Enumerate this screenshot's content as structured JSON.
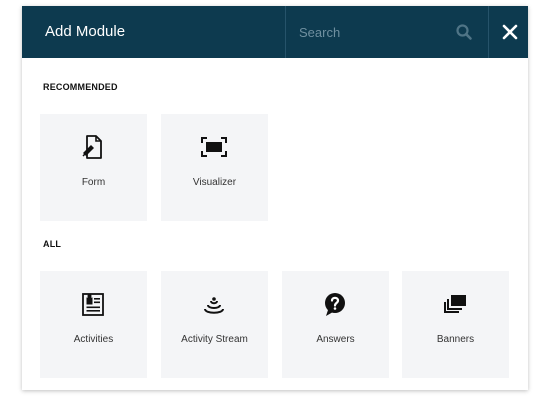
{
  "dialog": {
    "title": "Add Module",
    "search_placeholder": "Search"
  },
  "sections": {
    "recommended_label": "RECOMMENDED",
    "all_label": "ALL"
  },
  "recommended": [
    {
      "label": "Form",
      "icon": "form-icon"
    },
    {
      "label": "Visualizer",
      "icon": "visualizer-icon"
    }
  ],
  "all": [
    {
      "label": "Activities",
      "icon": "activities-icon"
    },
    {
      "label": "Activity Stream",
      "icon": "activity-stream-icon"
    },
    {
      "label": "Answers",
      "icon": "answers-icon"
    },
    {
      "label": "Banners",
      "icon": "banners-icon"
    }
  ],
  "colors": {
    "header_bg": "#0d3a4f",
    "tile_bg": "#f4f5f7"
  }
}
